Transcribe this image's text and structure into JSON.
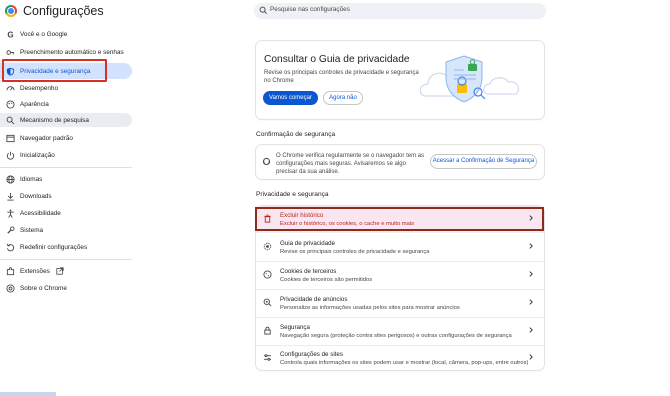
{
  "app": {
    "title": "Configurações"
  },
  "search": {
    "placeholder": "Pesquise nas configurações"
  },
  "sidebar": {
    "items": [
      {
        "label": "Você e o Google",
        "icon": "google-g-icon"
      },
      {
        "label": "Preenchimento automático e senhas",
        "icon": "key-icon"
      },
      {
        "label": "Privacidade e segurança",
        "icon": "shield-icon"
      },
      {
        "label": "Desempenho",
        "icon": "speedometer-icon"
      },
      {
        "label": "Aparência",
        "icon": "palette-icon"
      },
      {
        "label": "Mecanismo de pesquisa",
        "icon": "search-icon"
      },
      {
        "label": "Navegador padrão",
        "icon": "browser-icon"
      },
      {
        "label": "Inicialização",
        "icon": "power-icon"
      },
      {
        "label": "Idiomas",
        "icon": "globe-icon"
      },
      {
        "label": "Downloads",
        "icon": "download-icon"
      },
      {
        "label": "Acessibilidade",
        "icon": "accessibility-icon"
      },
      {
        "label": "Sistema",
        "icon": "wrench-icon"
      },
      {
        "label": "Redefinir configurações",
        "icon": "reset-icon"
      },
      {
        "label": "Extensões",
        "icon": "puzzle-icon"
      },
      {
        "label": "Sobre o Chrome",
        "icon": "chrome-icon"
      }
    ]
  },
  "guide": {
    "title": "Consultar o Guia de privacidade",
    "description": "Revise os principais controles de privacidade e segurança no Chrome",
    "primary_button": "Vamos começar",
    "secondary_button": "Agora não"
  },
  "safety_check": {
    "heading": "Confirmação de segurança",
    "text": "O Chrome verifica regularmente se o navegador tem as configurações mais seguras. Avisaremos se algo precisar da sua análise.",
    "button": "Acessar a Confirmação de Segurança"
  },
  "privacy": {
    "heading": "Privacidade e segurança",
    "rows": [
      {
        "title": "Excluir histórico",
        "subtitle": "Excluir o histórico, os cookies, o cache e muito mais",
        "icon": "trash-icon"
      },
      {
        "title": "Guia de privacidade",
        "subtitle": "Revise os principais controles de privacidade e segurança",
        "icon": "privacy-guide-icon"
      },
      {
        "title": "Cookies de terceiros",
        "subtitle": "Cookies de terceiros são permitidos",
        "icon": "cookie-icon"
      },
      {
        "title": "Privacidade de anúncios",
        "subtitle": "Personalize as informações usadas pelos sites para mostrar anúncios",
        "icon": "ad-privacy-icon"
      },
      {
        "title": "Segurança",
        "subtitle": "Navegação segura (proteção contra sites perigosos) e outras configurações de segurança",
        "icon": "lock-icon"
      },
      {
        "title": "Configurações de sites",
        "subtitle": "Controla quais informações os sites podem usar e mostrar (local, câmera, pop-ups, entre outros)",
        "icon": "sliders-icon"
      }
    ]
  },
  "colors": {
    "accent": "#0b57d0",
    "active_bg": "#d3e3fd",
    "highlight_row": "#fae6f1",
    "annotation_red": "#d93025"
  }
}
